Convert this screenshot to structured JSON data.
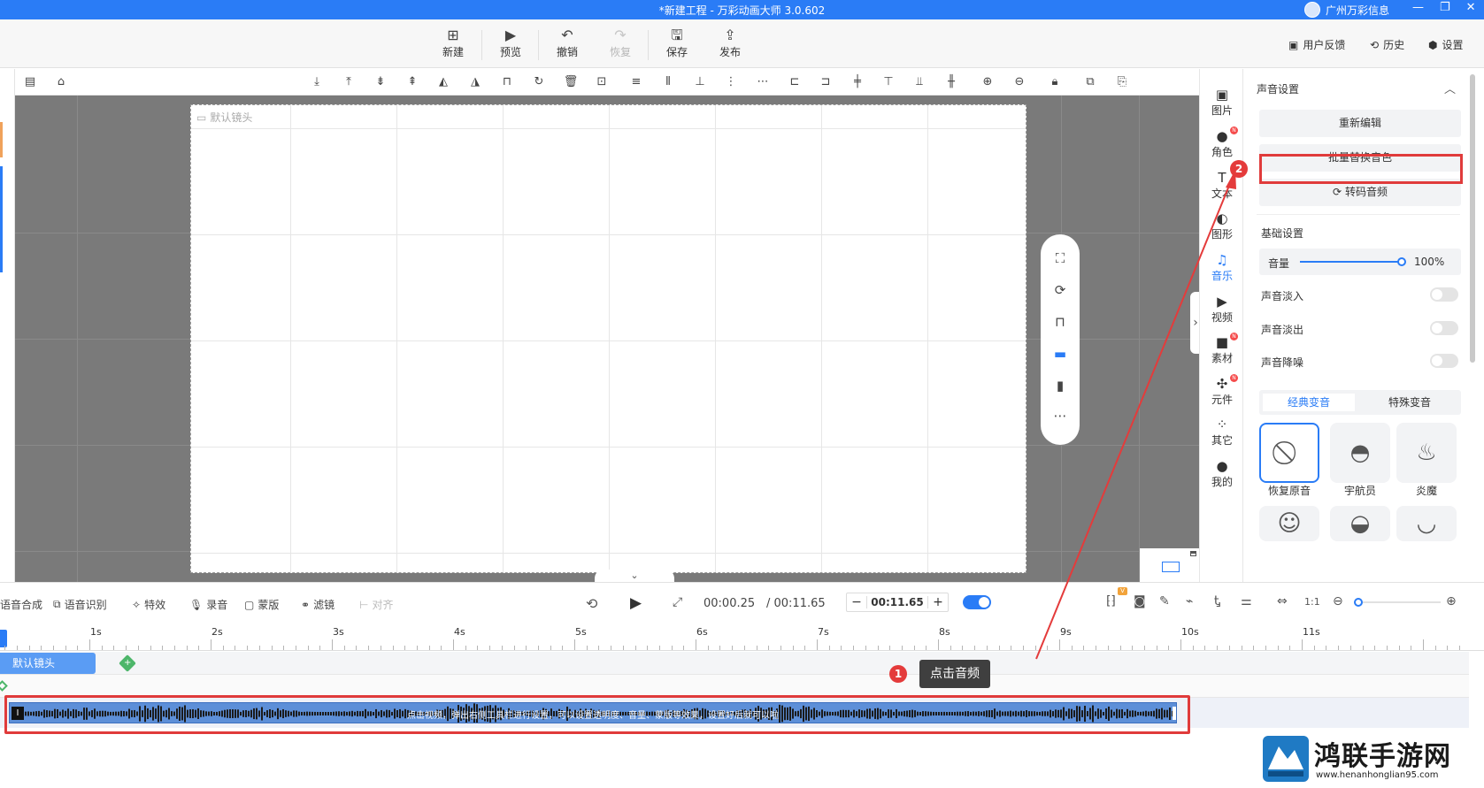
{
  "window": {
    "title": "*新建工程 - 万彩动画大师 3.0.602",
    "user_name": "广州万彩信息"
  },
  "toolbar": {
    "new": "新建",
    "preview": "预览",
    "undo": "撤销",
    "redo": "恢复",
    "save": "保存",
    "publish": "发布",
    "feedback": "用户反馈",
    "history": "历史",
    "settings": "设置"
  },
  "canvas": {
    "shot_label": "默认镜头"
  },
  "side_tabs": [
    "图片",
    "角色",
    "文本",
    "图形",
    "音乐",
    "视频",
    "素材",
    "元件",
    "其它",
    "我的"
  ],
  "side_tabs_active": "音乐",
  "props": {
    "sound_settings": "声音设置",
    "re_edit": "重新编辑",
    "batch_replace_voice": "批量替换音色",
    "transcode_audio": "转码音频",
    "basic_settings": "基础设置",
    "volume_label": "音量",
    "volume_value": "100%",
    "volume_level": 1.0,
    "fade_in": "声音淡入",
    "fade_out": "声音淡出",
    "noise_reduction": "声音降噪",
    "tab_classic": "经典变音",
    "tab_special": "特殊变音",
    "voices": [
      "恢复原音",
      "宇航员",
      "炎魔"
    ]
  },
  "timeline": {
    "tools": [
      "语音合成",
      "语音识别",
      "特效",
      "录音",
      "蒙版",
      "滤镜",
      "对齐"
    ],
    "current_time": "00:00.25",
    "total_time": "/ 00:11.65",
    "duration_field": "00:11.65",
    "ruler_labels": [
      "1s",
      "2s",
      "3s",
      "4s",
      "5s",
      "6s",
      "7s",
      "8s",
      "9s",
      "10s",
      "11s"
    ],
    "shot_clip": "默认镜头",
    "audio_caption": "点击视频，弹出右侧工具栏进行设置，可以设置透明度、音量、蒙版等效果，设置好后就可以啦",
    "audio_badge": "I"
  },
  "annotations": {
    "step1": "1",
    "step1_tip": "点击音频",
    "step2": "2"
  },
  "watermark": {
    "brand": "鸿联手游网",
    "url": "www.henanhonglian95.com"
  },
  "colors": {
    "accent": "#2a7cf6",
    "highlight": "#e03b3b",
    "canvas_bg": "#7a7a7a"
  },
  "icons": {
    "new": "plus-square-icon",
    "preview": "play-icon",
    "undo": "undo-icon",
    "redo": "redo-icon",
    "save": "save-icon",
    "publish": "upload-icon"
  }
}
